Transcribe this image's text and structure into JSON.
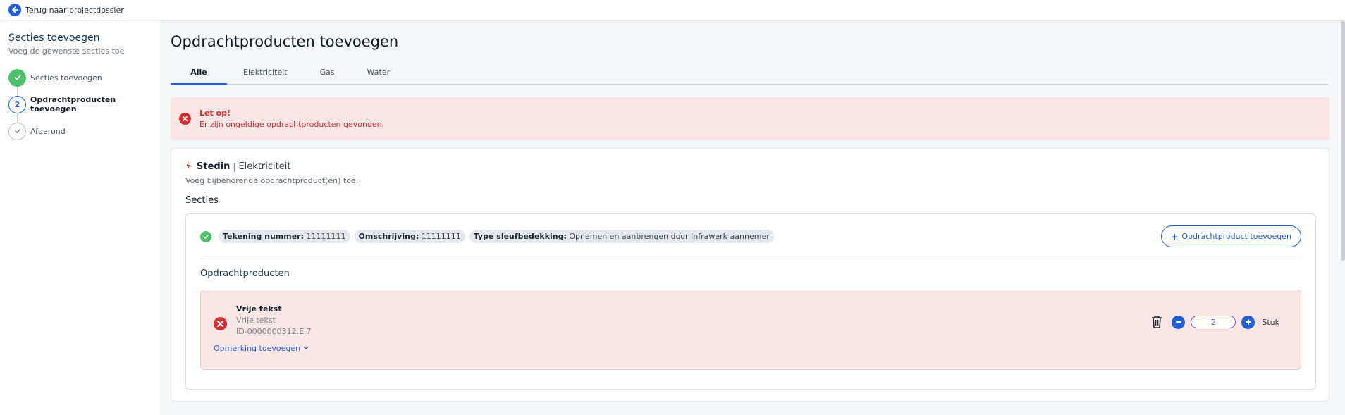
{
  "topbar": {
    "back_label": "Terug naar projectdossier"
  },
  "sidebar": {
    "title": "Secties toevoegen",
    "subtitle": "Voeg de gewenste secties toe",
    "steps": [
      {
        "label": "Secties toevoegen",
        "state": "done"
      },
      {
        "label": "Opdrachtproducten toevoegen",
        "state": "current",
        "number": "2"
      },
      {
        "label": "Afgerond",
        "state": "future"
      }
    ]
  },
  "main": {
    "title": "Opdrachtproducten toevoegen",
    "tabs": [
      {
        "label": "Alle",
        "active": true
      },
      {
        "label": "Elektriciteit"
      },
      {
        "label": "Gas"
      },
      {
        "label": "Water"
      }
    ],
    "alert": {
      "title": "Let op!",
      "message": "Er zijn ongeldige opdrachtproducten gevonden."
    },
    "card": {
      "company": "Stedin",
      "separator": "|",
      "domain": "Elektriciteit",
      "subtitle": "Voeg bijbehorende opdrachtproduct(en) toe.",
      "sections_title": "Secties",
      "section": {
        "chips": [
          {
            "key": "Tekening nummer:",
            "value": "11111111"
          },
          {
            "key": "Omschrijving:",
            "value": "11111111"
          },
          {
            "key": "Type sleufbedekking:",
            "value": "Opnemen en aanbrengen door Infrawerk aannemer"
          }
        ],
        "add_button_label": "Opdrachtproduct toevoegen",
        "products_title": "Opdrachtproducten",
        "product": {
          "name": "Vrije tekst",
          "description": "Vrije tekst",
          "id": "ID-0000000312.E.7",
          "remark_label": "Opmerking toevoegen",
          "quantity": "2",
          "unit": "Stuk"
        }
      }
    }
  },
  "colors": {
    "accent": "#1f5fd6",
    "error": "#d32f2f",
    "success": "#4cc36b",
    "error_bg": "#fbe6e6"
  }
}
